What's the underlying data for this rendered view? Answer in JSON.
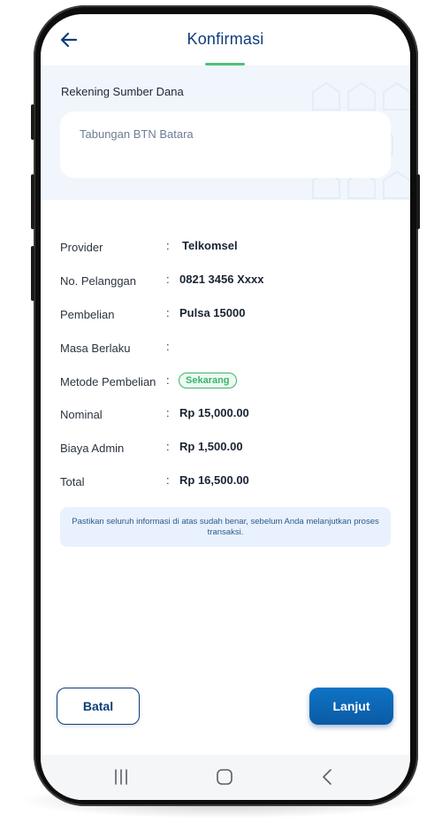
{
  "header": {
    "title": "Konfirmasi",
    "back_icon": "arrow-left-icon"
  },
  "source": {
    "label": "Rekening Sumber Dana",
    "account": "Tabungan BTN Batara"
  },
  "details": {
    "provider": {
      "label": "Provider",
      "colon": ":",
      "value": "Telkomsel"
    },
    "customer_no": {
      "label": "No. Pelanggan",
      "colon": ":",
      "value": "0821 3456 Xxxx"
    },
    "purchase": {
      "label": "Pembelian",
      "colon": ":",
      "value": "Pulsa 15000"
    },
    "validity": {
      "label": "Masa Berlaku",
      "colon": ":",
      "value": ""
    },
    "method": {
      "label": "Metode Pembelian",
      "colon": ":",
      "value": "Sekarang"
    },
    "nominal": {
      "label": "Nominal",
      "colon": ":",
      "value": "Rp 15,000.00"
    },
    "admin_fee": {
      "label": "Biaya Admin",
      "colon": ":",
      "value": "Rp 1,500.00"
    },
    "total": {
      "label": "Total",
      "colon": ":",
      "value": "Rp 16,500.00"
    }
  },
  "notice": "Pastikan seluruh informasi di atas sudah benar, sebelum Anda melanjutkan proses transaksi.",
  "buttons": {
    "cancel": "Batal",
    "continue": "Lanjut"
  },
  "colors": {
    "primary": "#0c3d7a",
    "accent_green": "#3bb46a",
    "button_blue": "#0b68b5"
  },
  "system_nav": {
    "recent": "recent-apps-icon",
    "home": "home-icon",
    "back": "back-chevron-icon"
  }
}
